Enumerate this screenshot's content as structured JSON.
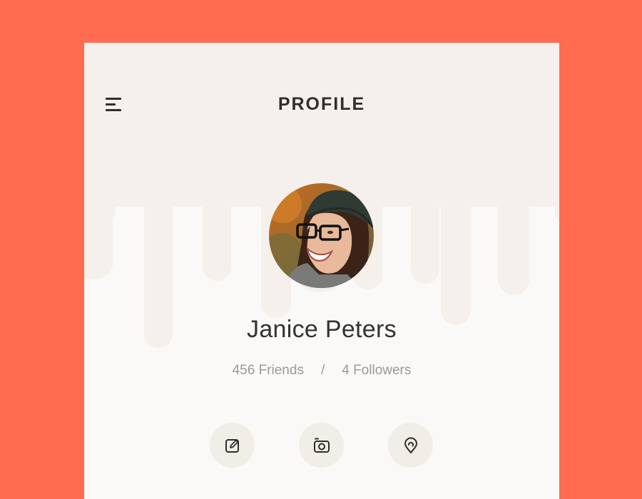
{
  "header": {
    "title": "PROFILE",
    "menu_icon": "hamburger-menu-icon"
  },
  "profile": {
    "name": "Janice Peters",
    "friends": "456 Friends",
    "separator": "/",
    "followers": "4 Followers",
    "avatar_description": "profile-photo"
  },
  "actions": [
    {
      "icon": "edit-icon"
    },
    {
      "icon": "camera-icon"
    },
    {
      "icon": "location-pin-icon"
    }
  ],
  "colors": {
    "background": "#FF6C4F",
    "card": "#FAF9F7",
    "card_top": "#F5F0EB",
    "action_bg": "#F1EDE7",
    "text_dark": "#2E2E2E",
    "text_muted": "#9A9A9A"
  }
}
